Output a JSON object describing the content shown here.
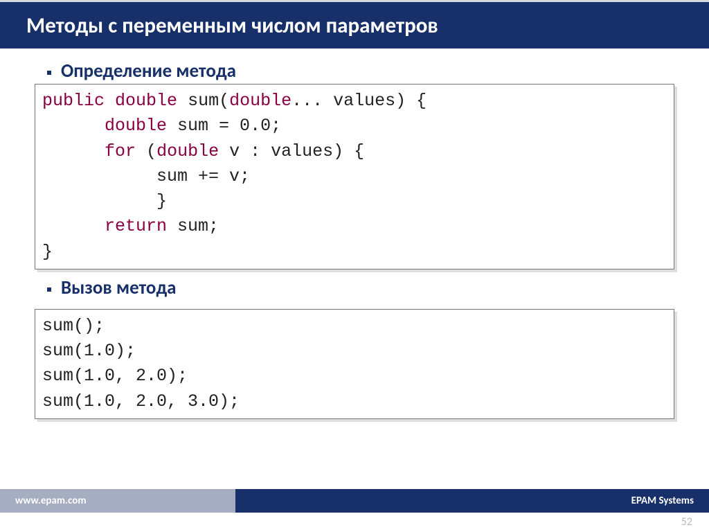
{
  "header": {
    "title": "Методы с переменным числом параметров"
  },
  "bullets": [
    "Определение метода",
    "Вызов метода"
  ],
  "code1": {
    "t0": "public",
    "t1": "double",
    "t2": "sum(",
    "t3": "double",
    "t4": "... values) {",
    "t5": "double",
    "t6": "sum = 0.0;",
    "t7": "for",
    "t8": "(",
    "t9": "double",
    "t10": "v : values) {",
    "t11": "sum += v;",
    "t12": "}",
    "t13": "return",
    "t14": "sum;",
    "t15": "}"
  },
  "code2": {
    "l0": "sum();",
    "l1": "sum(1.0);",
    "l2": "sum(1.0, 2.0);",
    "l3": "sum(1.0, 2.0, 3.0);"
  },
  "footer": {
    "left": "www.epam.com",
    "right": "EPAM Systems",
    "page": "52"
  }
}
